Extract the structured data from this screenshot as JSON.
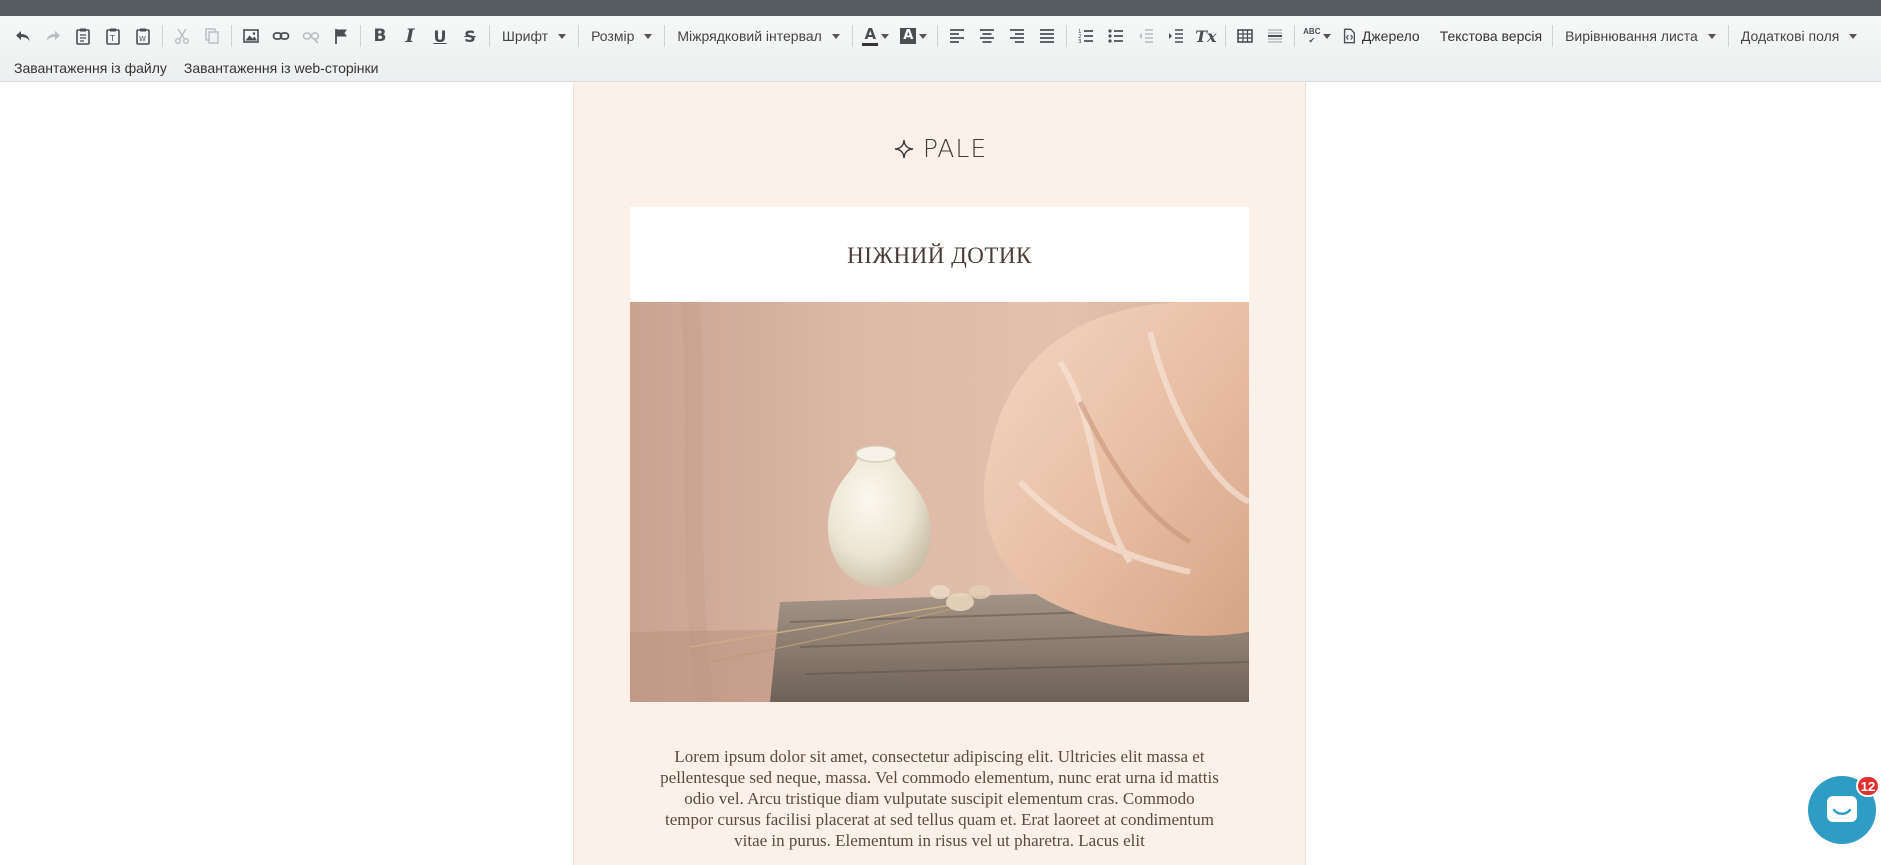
{
  "toolbar": {
    "font_label": "Шрифт",
    "size_label": "Розмір",
    "line_spacing_label": "Міжрядковий інтервал",
    "source_label": "Джерело",
    "text_version_label": "Текстова версія",
    "align_letter_label": "Вирівнювання листа",
    "extra_fields_label": "Додаткові поля",
    "bold_glyph": "B",
    "italic_glyph": "I",
    "underline_glyph": "U",
    "strike_glyph": "S",
    "font_color_glyph": "A",
    "bg_color_glyph": "A",
    "spellcheck_glyph": "ABC",
    "clear_format_glyph": "Tx"
  },
  "upload": {
    "from_file": "Завантаження із файлу",
    "from_web": "Завантаження із web-сторінки"
  },
  "email": {
    "logo_text": "PALE",
    "logo_icon": "sparkle-icon",
    "title": "НІЖНИЙ ДОТИК",
    "body": "Lorem ipsum dolor sit amet, consectetur adipiscing elit. Ultricies elit massa et pellentesque sed neque, massa. Vel commodo elementum, nunc erat urna id mattis odio vel. Arcu tristique diam vulputate suscipit elementum cras. Commodo tempor cursus facilisi placerat at sed tellus quam et. Erat laoreet at condimentum vitae in purus. Elementum in risus vel ut pharetra. Lacus elit"
  },
  "chat": {
    "badge_count": "12",
    "accent": "#2f9cc4"
  },
  "colors": {
    "topbar": "#555c62",
    "canvas_bg": "#fcf1e9",
    "badge": "#e03131"
  }
}
